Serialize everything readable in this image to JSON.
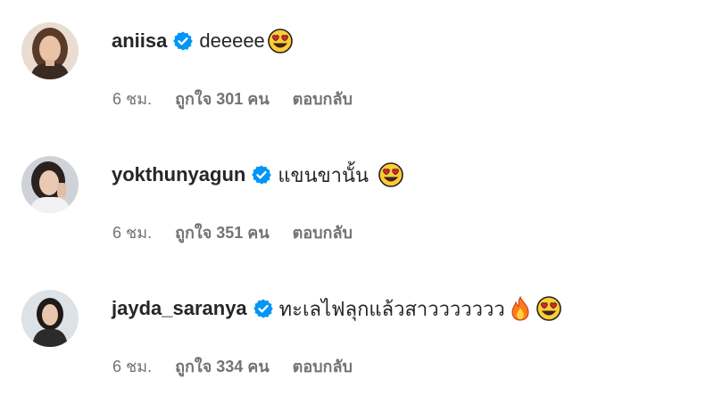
{
  "colors": {
    "text": "#262626",
    "meta": "#737373",
    "verified": "#0095f6",
    "background": "#ffffff"
  },
  "comments": [
    {
      "username": "aniisa",
      "verified": true,
      "text": "deeeee",
      "emojis": [
        "heart-eyes-emoji"
      ],
      "time": "6 ชม.",
      "likes": "ถูกใจ 301 คน",
      "reply": "ตอบกลับ"
    },
    {
      "username": "yokthunyagun",
      "verified": true,
      "text": "แขนขานั้น",
      "emojis": [
        "heart-eyes-emoji"
      ],
      "time": "6 ชม.",
      "likes": "ถูกใจ 351 คน",
      "reply": "ตอบกลับ"
    },
    {
      "username": "jayda_saranya",
      "verified": true,
      "text": "ทะเลไฟลุกแล้วสาววววววว",
      "emojis": [
        "fire-emoji",
        "heart-eyes-emoji"
      ],
      "time": "6 ชม.",
      "likes": "ถูกใจ 334 คน",
      "reply": "ตอบกลับ"
    }
  ]
}
